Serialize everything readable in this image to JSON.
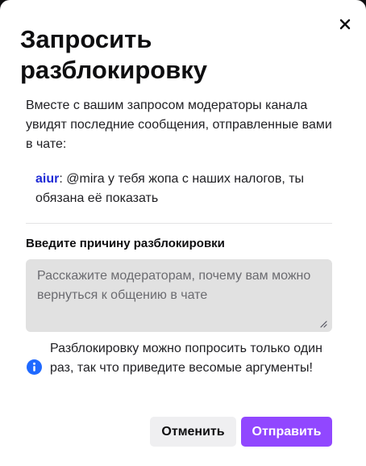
{
  "dialog": {
    "title": "Запросить разблокировку",
    "intro": "Вместе с вашим запросом модераторы канала увидят последние сообщения, отправленные вами в чате:",
    "message": {
      "username": "aiur",
      "separator": ":",
      "text": " @mira у тебя жопа с наших налогов, ты обязана её показать"
    },
    "reason_label": "Введите причину разблокировки",
    "reason_input": {
      "value": "",
      "placeholder": "Расскажите модераторам, почему вам можно вернуться к общению в чате"
    },
    "info_text": "Разблокировку можно попросить только один раз, так что приведите весомые аргументы!",
    "cancel_label": "Отменить",
    "submit_label": "Отправить"
  },
  "icons": {
    "close": "close-icon",
    "info": "info-icon",
    "resize": "resize-handle-icon"
  },
  "colors": {
    "accent": "#9147ff",
    "username": "#1f2bd6",
    "info_icon": "#1f69ff",
    "input_background": "#e1e1e1",
    "cancel_background": "#efeff1"
  }
}
